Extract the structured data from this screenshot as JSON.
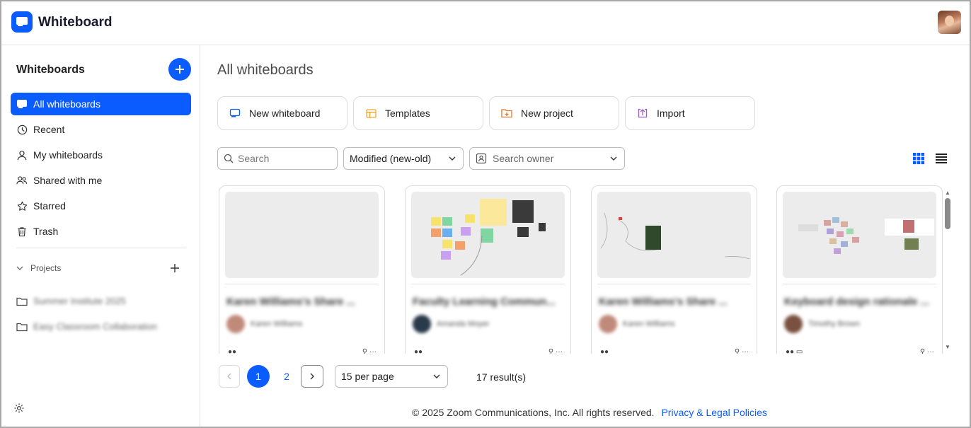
{
  "app": {
    "title": "Whiteboard",
    "logo_icon": "whiteboard-logo-icon",
    "accent": "#0b5cff"
  },
  "sidebar": {
    "title": "Whiteboards",
    "add_icon": "plus-icon",
    "items": [
      {
        "label": "All whiteboards",
        "icon": "whiteboard-icon",
        "active": true
      },
      {
        "label": "Recent",
        "icon": "clock-icon"
      },
      {
        "label": "My whiteboards",
        "icon": "person-icon"
      },
      {
        "label": "Shared with me",
        "icon": "people-icon"
      },
      {
        "label": "Starred",
        "icon": "star-icon"
      },
      {
        "label": "Trash",
        "icon": "trash-icon"
      }
    ],
    "projects": {
      "label": "Projects",
      "items": [
        {
          "label": "Summer Institute 2025"
        },
        {
          "label": "Easy Classroom Collaboration"
        }
      ]
    }
  },
  "main": {
    "title": "All whiteboards",
    "actions": [
      {
        "label": "New whiteboard",
        "icon": "whiteboard-icon",
        "color": "#0b5cff"
      },
      {
        "label": "Templates",
        "icon": "template-icon",
        "color": "#f0a020"
      },
      {
        "label": "New project",
        "icon": "folder-plus-icon",
        "color": "#e0772a"
      },
      {
        "label": "Import",
        "icon": "import-icon",
        "color": "#9b59d0"
      }
    ],
    "filters": {
      "search_placeholder": "Search",
      "sort_value": "Modified (new-old)",
      "owner_placeholder": "Search owner"
    },
    "cards": [
      {
        "title": "Karen Williams's Share ...",
        "owner": "Karen Williams"
      },
      {
        "title": "Faculty Learning Commun...",
        "owner": "Amanda Moyer"
      },
      {
        "title": "Karen Williams's Share ...",
        "owner": "Karen Williams"
      },
      {
        "title": "Keyboard design rationale ...",
        "owner": "Timothy Brown"
      }
    ],
    "pagination": {
      "current": "1",
      "next_page": "2",
      "per_page": "15 per page",
      "results": "17 result(s)"
    }
  },
  "footer": {
    "copyright": "© 2025 Zoom Communications, Inc. All rights reserved.",
    "link": "Privacy & Legal Policies"
  }
}
